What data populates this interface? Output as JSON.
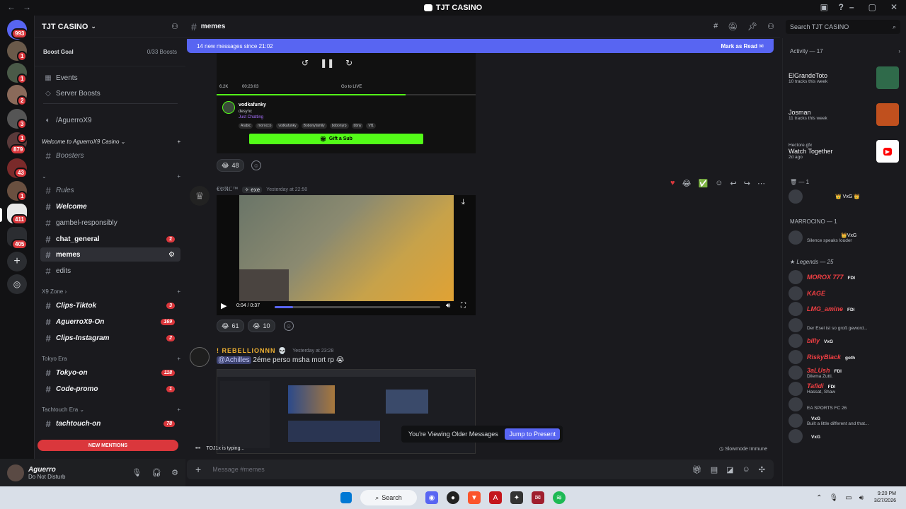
{
  "window": {
    "title": "TJT CASINO"
  },
  "servers": {
    "badges": [
      "993",
      "1",
      "1",
      "2",
      "3",
      "1",
      "879",
      "43",
      "1",
      "411",
      "405"
    ]
  },
  "guild": {
    "name": "TJT CASINO",
    "boost_label": "Boost Goal",
    "boost_count": "0/33 Boosts",
    "events": "Events",
    "server_boosts": "Server Boosts",
    "voice_channel": "/AguerroX9"
  },
  "channels": {
    "cat_welcome": "Welcome to AguerroX9 Casino",
    "boosters": "Boosters",
    "rules": "Rules",
    "welcome": "Welcome",
    "gambel": "gambel-responsibly",
    "chat_general": "chat_general",
    "chat_general_badge": "2",
    "memes": "memes",
    "edits": "edits",
    "cat_x9": "X9 Zone",
    "clips_tiktok": "Clips-Tiktok",
    "clips_tiktok_badge": "3",
    "aguerrox9_on": "AguerroX9-On",
    "aguerrox9_on_badge": "169",
    "clips_instagram": "Clips-Instagram",
    "clips_instagram_badge": "2",
    "cat_tokyo": "Tokyo Era",
    "tokyo_on": "Tokyo-on",
    "tokyo_on_badge": "118",
    "code_promo": "Code-promo",
    "code_promo_badge": "1",
    "cat_tachtouch": "Tachtouch Era",
    "tachtouch_on": "tachtouch-on",
    "tachtouch_on_badge": "78",
    "new_mentions": "NEW MENTIONS"
  },
  "user": {
    "name": "Aguerro",
    "status": "Do Not Disturb"
  },
  "chat": {
    "channel": "memes",
    "banner_text": "14 new messages since 21:02",
    "mark_read": "Mark as Read",
    "msg1": {
      "stream_time": "00:23:03",
      "viewers": "6.2K",
      "go_live": "Go to LIVE",
      "streamer": "vodkafunky",
      "stream_sub1": "desync",
      "stream_sub2": "Just Chatting",
      "tags": [
        "Arabic",
        "morocco",
        "vodkafunky",
        "Bobonyfamily",
        "bobonyrp",
        "bbny",
        "Vf1"
      ],
      "gift": "Gift a Sub",
      "reaction_count": "48"
    },
    "msg2": {
      "author": "€𝔅ℜℂ™",
      "tag": "exe",
      "time": "Yesterday at 22:50",
      "video_time": "0:04 / 0:37",
      "progress": 0.11,
      "react1_count": "61",
      "react2_count": "10"
    },
    "msg3": {
      "author": "REBELLIONNN",
      "time": "Yesterday at 23:28",
      "mention": "@Achilles",
      "text": "2éme perso msha mort rp"
    },
    "older_notice": "You're Viewing Older Messages",
    "jump_present": "Jump to Present",
    "typing": "TOJ1x is typing...",
    "slowmode": "Slowmode Immune",
    "composer_placeholder": "Message #memes",
    "search_placeholder": "Search TJT CASINO"
  },
  "members": {
    "activity_title": "Activity — 17",
    "activity": [
      {
        "name": "ElGrandeToto",
        "sub": "10 tracks this week"
      },
      {
        "name": "Josman",
        "sub": "11 tracks this week"
      },
      {
        "name": "Watch Together",
        "sub": "2d ago",
        "user": "Hectore.gfx"
      }
    ],
    "group1_title": "— 1",
    "group1_member": "VxG",
    "marrocino_title": "MARROCINO — 1",
    "marrocino_member": {
      "tag": "VxG",
      "sub": "Silence speaks louder"
    },
    "legends_title": "Legends — 25",
    "legends": [
      {
        "name": "MOROX 777",
        "tag": "FDI",
        "sub": ""
      },
      {
        "name": "KAGE",
        "tag": "",
        "sub": ""
      },
      {
        "name": "LMG_amine",
        "tag": "FDI",
        "sub": ""
      },
      {
        "name": "",
        "tag": "",
        "sub": "Der Esel ist so groß geword..."
      },
      {
        "name": "billy",
        "tag": "VxG",
        "sub": ""
      },
      {
        "name": "RiskyBlack",
        "tag": "goth",
        "sub": ""
      },
      {
        "name": "3aLUsh",
        "tag": "FDI",
        "sub": "Dilema Zutti."
      },
      {
        "name": "Tafidi",
        "tag": "FDI",
        "sub": "Hassat, Shaw"
      },
      {
        "name": "",
        "tag": "",
        "sub": "EA SPORTS FC 26"
      },
      {
        "name": "",
        "tag": "VxG",
        "sub": "Built a little different and that..."
      },
      {
        "name": "",
        "tag": "VxG",
        "sub": ""
      }
    ]
  },
  "taskbar": {
    "search": "Search",
    "time": "9:20 PM",
    "date": "3/27/2026"
  },
  "colors": {
    "accent": "#5865f2",
    "danger": "#da373c",
    "green": "#23a559",
    "twitch_green": "#53fc18"
  }
}
